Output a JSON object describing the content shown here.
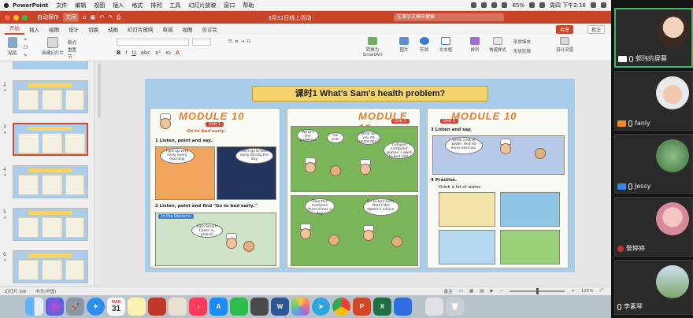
{
  "menubar": {
    "app_name": "PowerPoint",
    "items": [
      "文件",
      "编辑",
      "视图",
      "插入",
      "格式",
      "排列",
      "工具",
      "幻灯片放映",
      "窗口",
      "帮助"
    ],
    "battery": "65%",
    "clock": "周四 下午2:16"
  },
  "titlebar": {
    "autosave_label": "自动保存",
    "autosave_state": "关闭",
    "doc_title": "3月31日线上活动",
    "search_placeholder": "在演示文稿中搜索"
  },
  "ribbon_tabs": {
    "tabs": [
      "开始",
      "插入",
      "绘图",
      "设计",
      "切换",
      "动画",
      "幻灯片放映",
      "审阅",
      "视图"
    ],
    "tell_me": "告诉我",
    "share_label": "共享",
    "comments_label": "批注"
  },
  "ribbon": {
    "paste": "粘贴",
    "new_slide": "新建幻灯片",
    "layout": "版式",
    "reset": "重置",
    "section": "节",
    "convert_smartart": "转换为SmartArt",
    "picture": "图片",
    "shapes": "形状",
    "textbox": "文本框",
    "arrange": "排列",
    "quick_styles": "快速样式",
    "shape_fill": "形状填充",
    "shape_outline": "形状轮廓",
    "design_ideas": "设计灵感",
    "format_buttons": [
      "B",
      "I",
      "U",
      "abc",
      "x²",
      "x₂",
      "A"
    ]
  },
  "slides": [
    {
      "number": "",
      "selected": false
    },
    {
      "number": "2",
      "selected": false
    },
    {
      "number": "3",
      "selected": true
    },
    {
      "number": "4",
      "selected": false
    },
    {
      "number": "5",
      "selected": false
    },
    {
      "number": "6",
      "selected": false
    }
  ],
  "slide": {
    "title": "课时1  What's Sam's health problem?",
    "left_panel": {
      "module": "MODULE 10",
      "unit": "Unit 1",
      "subtitle": "Go to bed early.",
      "task1": "1  Listen, point and say.",
      "bubble1": "I get up very early every morning.",
      "bubble2": "Let's go to bed early during the day.",
      "task2": "2  Listen, point and find \"Go to bed early.\"",
      "label": "In the Doctor's",
      "bubble3": "Sam Smart. Come in, please!"
    },
    "middle_panel": {
      "module": "MODULE 10",
      "unit": "Unit 1",
      "bubble1": "What's the problem?",
      "bubble2": "I'm sick.",
      "bubble3": "What did you do yesterday?",
      "bubble4": "I played computer games. I went to bed late.",
      "bubble5": "Take this medicine three times a day.",
      "bubble6": "Go to bed early, that's the doctor's advice."
    },
    "right_panel": {
      "module": "MODULE 10",
      "unit": "Unit 1",
      "task3": "3  Listen and say.",
      "bubble1": "Drink a lot of water. And do more exercise.",
      "task4": "4  Practise.",
      "sub": "Drink a lot of water."
    }
  },
  "statusbar": {
    "slide_position": "幻灯片 3/8",
    "language": "中文(中国)",
    "notes": "备注",
    "zoom": "125%"
  },
  "dock": {
    "calendar_day": "31",
    "calendar_month": "MAR",
    "items": [
      "Finder",
      "Siri",
      "Launchpad",
      "Safari",
      "Calendar",
      "Notes",
      "Photo Booth",
      "Preview",
      "Music",
      "App Store",
      "WeChat",
      "Office",
      "Word",
      "Photos",
      "Telegram",
      "Chrome",
      "PowerPoint",
      "Excel",
      "Lark",
      "Screenshot",
      "Trash"
    ]
  },
  "participants": [
    {
      "name": "郭玮的屏幕",
      "cam": "off",
      "speaking": true
    },
    {
      "name": "fanly",
      "cam": "orange",
      "speaking": false
    },
    {
      "name": "Jessy",
      "cam": "blue",
      "speaking": false
    },
    {
      "name": "黎婷婷",
      "cam": "logo",
      "speaking": false
    },
    {
      "name": "李素琴",
      "cam": "none",
      "speaking": false
    }
  ],
  "colors": {
    "accent": "#c9452a",
    "slide_bg": "#a8cdea",
    "title_band": "#f3d36a",
    "speaking_border": "#42b96a"
  }
}
